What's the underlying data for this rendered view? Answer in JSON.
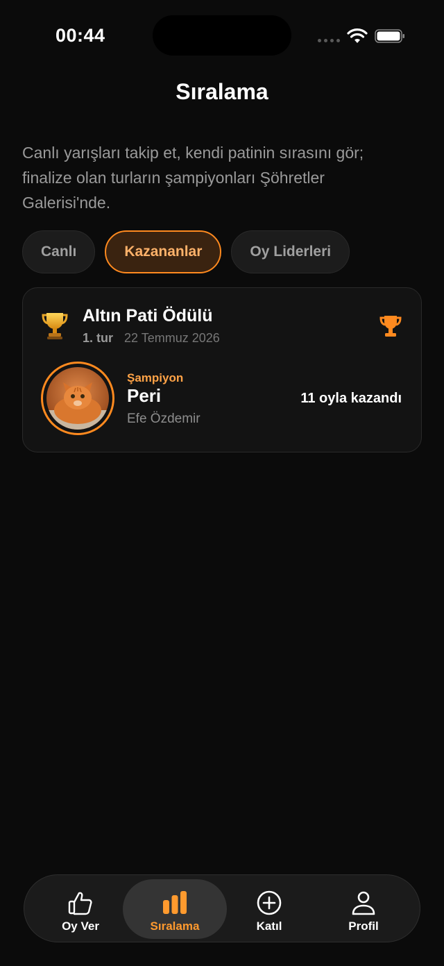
{
  "status_bar": {
    "time": "00:44"
  },
  "header": {
    "title": "Sıralama",
    "intro": "Canlı yarışları takip et, kendi patinin sırasını gör; finalize olan turların şampiyonları Şöhretler Galerisi'nde."
  },
  "tabs": [
    {
      "label": "Canlı",
      "active": false
    },
    {
      "label": "Kazananlar",
      "active": true
    },
    {
      "label": "Oy Liderleri",
      "active": false
    }
  ],
  "award_card": {
    "title": "Altın Pati Ödülü",
    "round": "1. tur",
    "date": "22 Temmuz 2026",
    "champion_label": "Şampiyon",
    "pet_name": "Peri",
    "owner": "Efe Özdemir",
    "votes_text": "11 oyla kazandı"
  },
  "nav": [
    {
      "label": "Oy Ver",
      "icon": "thumbs-up-icon",
      "active": false
    },
    {
      "label": "Sıralama",
      "icon": "bar-chart-icon",
      "active": true
    },
    {
      "label": "Katıl",
      "icon": "plus-circle-icon",
      "active": false
    },
    {
      "label": "Profil",
      "icon": "person-icon",
      "active": false
    }
  ],
  "colors": {
    "accent": "#ff8a1f",
    "background": "#0b0b0b",
    "card": "#131313"
  }
}
